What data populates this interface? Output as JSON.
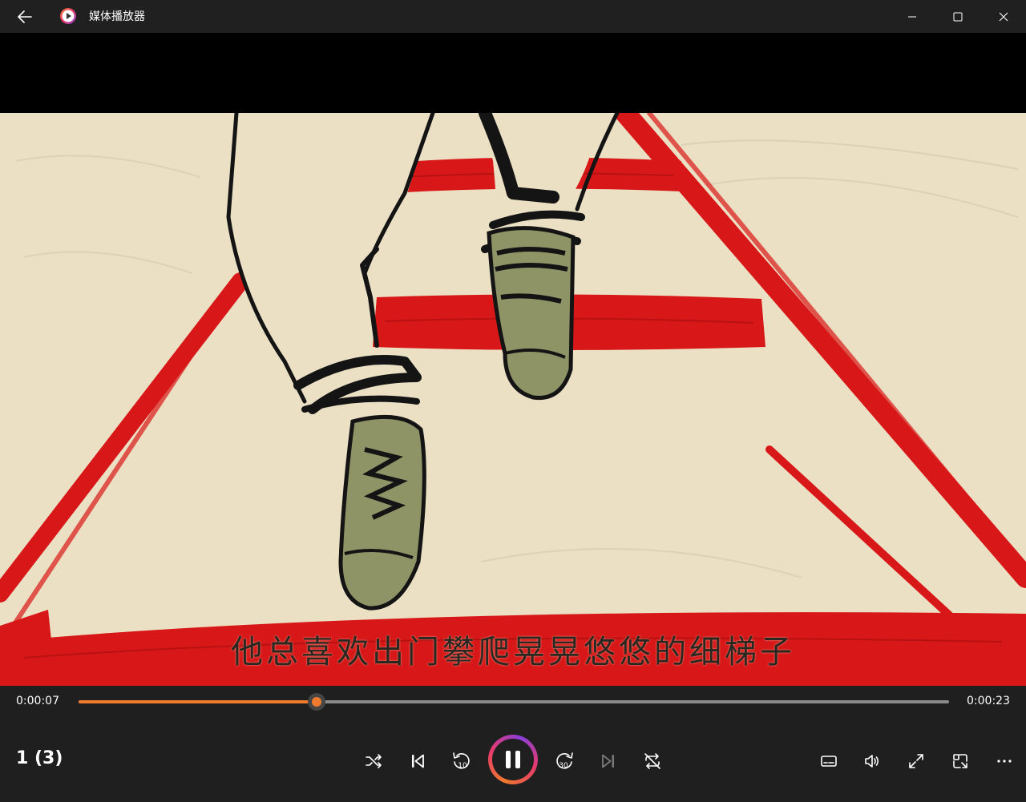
{
  "window": {
    "title": "媒体播放器"
  },
  "icons": {
    "back": "back-arrow-icon",
    "app": "media-player-logo-icon",
    "minimize": "minimize-icon",
    "maximize": "maximize-icon",
    "close": "close-icon",
    "shuffle": "shuffle-icon",
    "previous": "previous-track-icon",
    "rewind": "rewind-10-icon",
    "pause": "pause-icon",
    "forward": "forward-30-icon",
    "next": "next-track-icon",
    "repeat": "repeat-off-icon",
    "subtitles": "subtitles-icon",
    "volume": "volume-icon",
    "fullscreen": "fullscreen-icon",
    "miniplayer": "mini-player-icon",
    "more": "more-options-icon"
  },
  "player": {
    "subtitle": "他总喜欢出门攀爬晃晃悠悠的细梯子",
    "current_time": "0:00:07",
    "total_time": "0:00:23",
    "progress_fraction": 0.2735,
    "queue_position": "1 (3)",
    "rewind_seconds": "10",
    "forward_seconds": "30"
  },
  "colors": {
    "accent": "#f07a2e",
    "titlebar": "#202020",
    "panel": "#1f1f1f"
  }
}
